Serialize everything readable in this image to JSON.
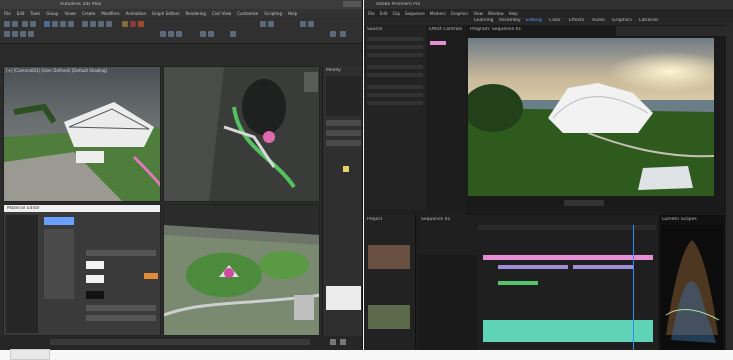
{
  "max": {
    "title": "Autodesk 3ds Max",
    "menu": [
      "File",
      "Edit",
      "Tools",
      "Group",
      "Views",
      "Create",
      "Modifiers",
      "Animation",
      "Graph Editors",
      "Rendering",
      "Civil View",
      "Customize",
      "Scripting",
      "Help"
    ],
    "viewports": [
      "[+] [Camera001] [User Defined] [Default Shading]",
      "[+] [Top] [User Defined]",
      "[+] [Perspective]"
    ],
    "material_editor_title": "Material Editor",
    "command_panel_title": "Modify"
  },
  "premiere": {
    "title": "Adobe Premiere Pro",
    "menu": [
      "File",
      "Edit",
      "Clip",
      "Sequence",
      "Markers",
      "Graphics",
      "View",
      "Window",
      "Help"
    ],
    "workspace_tabs": [
      "Learning",
      "Assembly",
      "Editing",
      "Color",
      "Effects",
      "Audio",
      "Graphics",
      "Libraries"
    ],
    "source_panel_title": "Source",
    "effect_controls_title": "Effect Controls",
    "program_title": "Program: Sequence 01",
    "project_title": "Project",
    "timeline_title": "Sequence 01",
    "scope_title": "Lumetri Scopes"
  },
  "colors": {
    "max_bg": "#2b2b2b",
    "premiere_bg": "#1e1e1e",
    "clip_pink": "#e58fd6",
    "clip_purple": "#9a8fd8",
    "clip_green": "#55c46a",
    "audio_teal": "#5fd3b5",
    "accent_blue": "#2d8cff"
  }
}
